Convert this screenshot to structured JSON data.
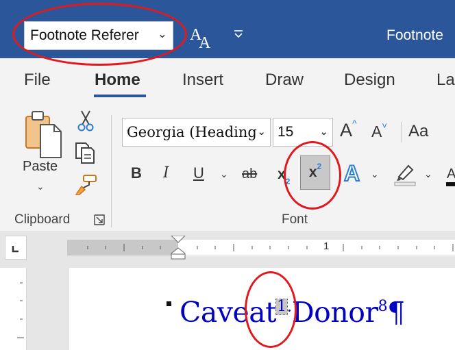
{
  "title_bar": {
    "style_name": "Footnote Referer",
    "document_title": "Footnote",
    "style_icon": "styles-aa-icon",
    "qat_icon": "customize-qat-icon",
    "background_color": "#2b579a"
  },
  "tabs": [
    {
      "label": "File",
      "active": false
    },
    {
      "label": "Home",
      "active": true
    },
    {
      "label": "Insert",
      "active": false
    },
    {
      "label": "Draw",
      "active": false
    },
    {
      "label": "Design",
      "active": false
    },
    {
      "label": "La",
      "active": false
    }
  ],
  "clipboard": {
    "paste_label": "Paste",
    "group_label": "Clipboard",
    "icons": [
      "paste-icon",
      "cut-icon",
      "copy-icon",
      "format-painter-icon",
      "dialog-launcher-icon"
    ]
  },
  "font_group": {
    "font_name": "Georgia (Heading",
    "font_size": "15",
    "group_label": "Font",
    "change_case_label": "Aa",
    "bold": "B",
    "italic": "I",
    "underline": "U",
    "strikethrough": "ab",
    "subscript_base": "x",
    "subscript_mark": "2",
    "superscript_base": "x",
    "superscript_mark": "2",
    "superscript_active": true,
    "icons": [
      "grow-font-icon",
      "shrink-font-icon",
      "text-effects-icon",
      "highlight-icon",
      "font-color-icon"
    ]
  },
  "ruler": {
    "marker_label": "1"
  },
  "document": {
    "word1": "Caveat",
    "note1": "1",
    "space_mark": "·",
    "word2": "Donor",
    "note2": "8",
    "pilcrow": "¶",
    "text_color": "#0000c0"
  },
  "annotations": {
    "color": "#e0191f",
    "targets": [
      "style-box",
      "superscript-button",
      "footnote-reference"
    ]
  }
}
